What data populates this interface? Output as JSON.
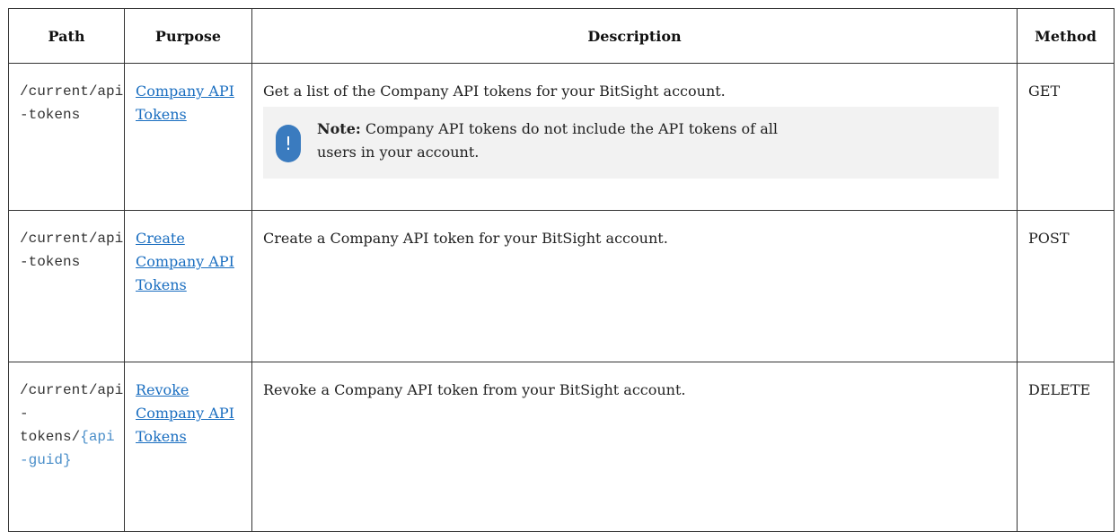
{
  "table": {
    "headers": [
      "Path",
      "Purpose",
      "Description",
      "Method"
    ],
    "rows": [
      {
        "path_line1": "/current/api",
        "path_line2": "-tokens",
        "path_param_line1": "",
        "path_param_line2": "",
        "purpose": "Company API Tokens",
        "description": "Get a list of the Company API tokens for your BitSight account.",
        "note_label": "Note:",
        "note_text": "Company API tokens do not include the API tokens of all users in your account.",
        "method": "GET"
      },
      {
        "path_line1": "/current/api",
        "path_line2": "-tokens",
        "purpose": "Create Company API Tokens",
        "description": "Create a Company API token for your BitSight account.",
        "method": "POST"
      },
      {
        "path_line1": "/current/api",
        "path_line2": "-tokens/",
        "path_param_a": "{api",
        "path_param_b": "-guid}",
        "purpose": "Revoke Company API Tokens",
        "description": "Revoke a Company API token from your BitSight account.",
        "method": "DELETE"
      }
    ]
  },
  "icons": {
    "note": "exclamation-icon"
  },
  "colors": {
    "link": "#1a6ec0",
    "param": "#4a8ec9",
    "note_bg": "#f2f2f2",
    "note_icon": "#3a7bbf"
  }
}
